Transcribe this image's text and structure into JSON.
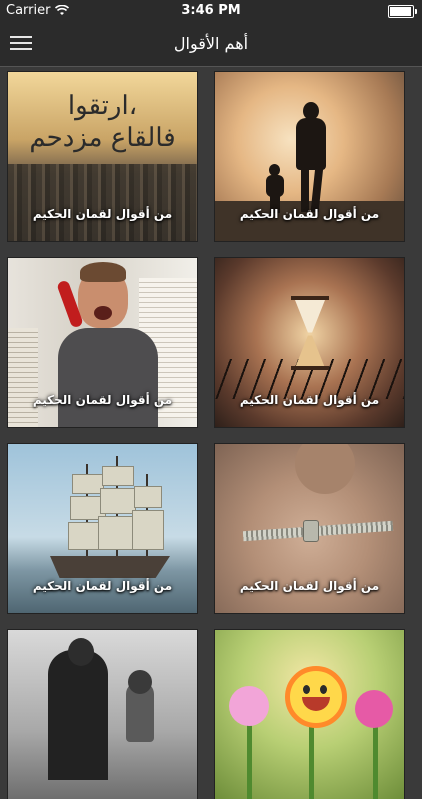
{
  "status_bar": {
    "carrier": "Carrier",
    "time": "3:46 PM",
    "battery_level": 0.95,
    "icons": [
      "wifi-icon",
      "battery-icon"
    ]
  },
  "nav_bar": {
    "title": "أهم الأقوال",
    "menu_icon": "hamburger-menu-icon"
  },
  "cards": [
    {
      "caption": "من أقوال لقمان الحكيم",
      "calligraphy": "ارتقوا،\nفالقاع مزدحم"
    },
    {
      "caption": "من أقوال لقمان الحكيم"
    },
    {
      "caption": "من أقوال لقمان الحكيم"
    },
    {
      "caption": "من أقوال لقمان الحكيم"
    },
    {
      "caption": "من أقوال لقمان الحكيم"
    },
    {
      "caption": "من أقوال لقمان الحكيم"
    },
    {
      "caption": ""
    },
    {
      "caption": ""
    }
  ],
  "colors": {
    "background": "#3a3a3a",
    "bar": "#2b2b2b",
    "text": "#ffffff"
  }
}
